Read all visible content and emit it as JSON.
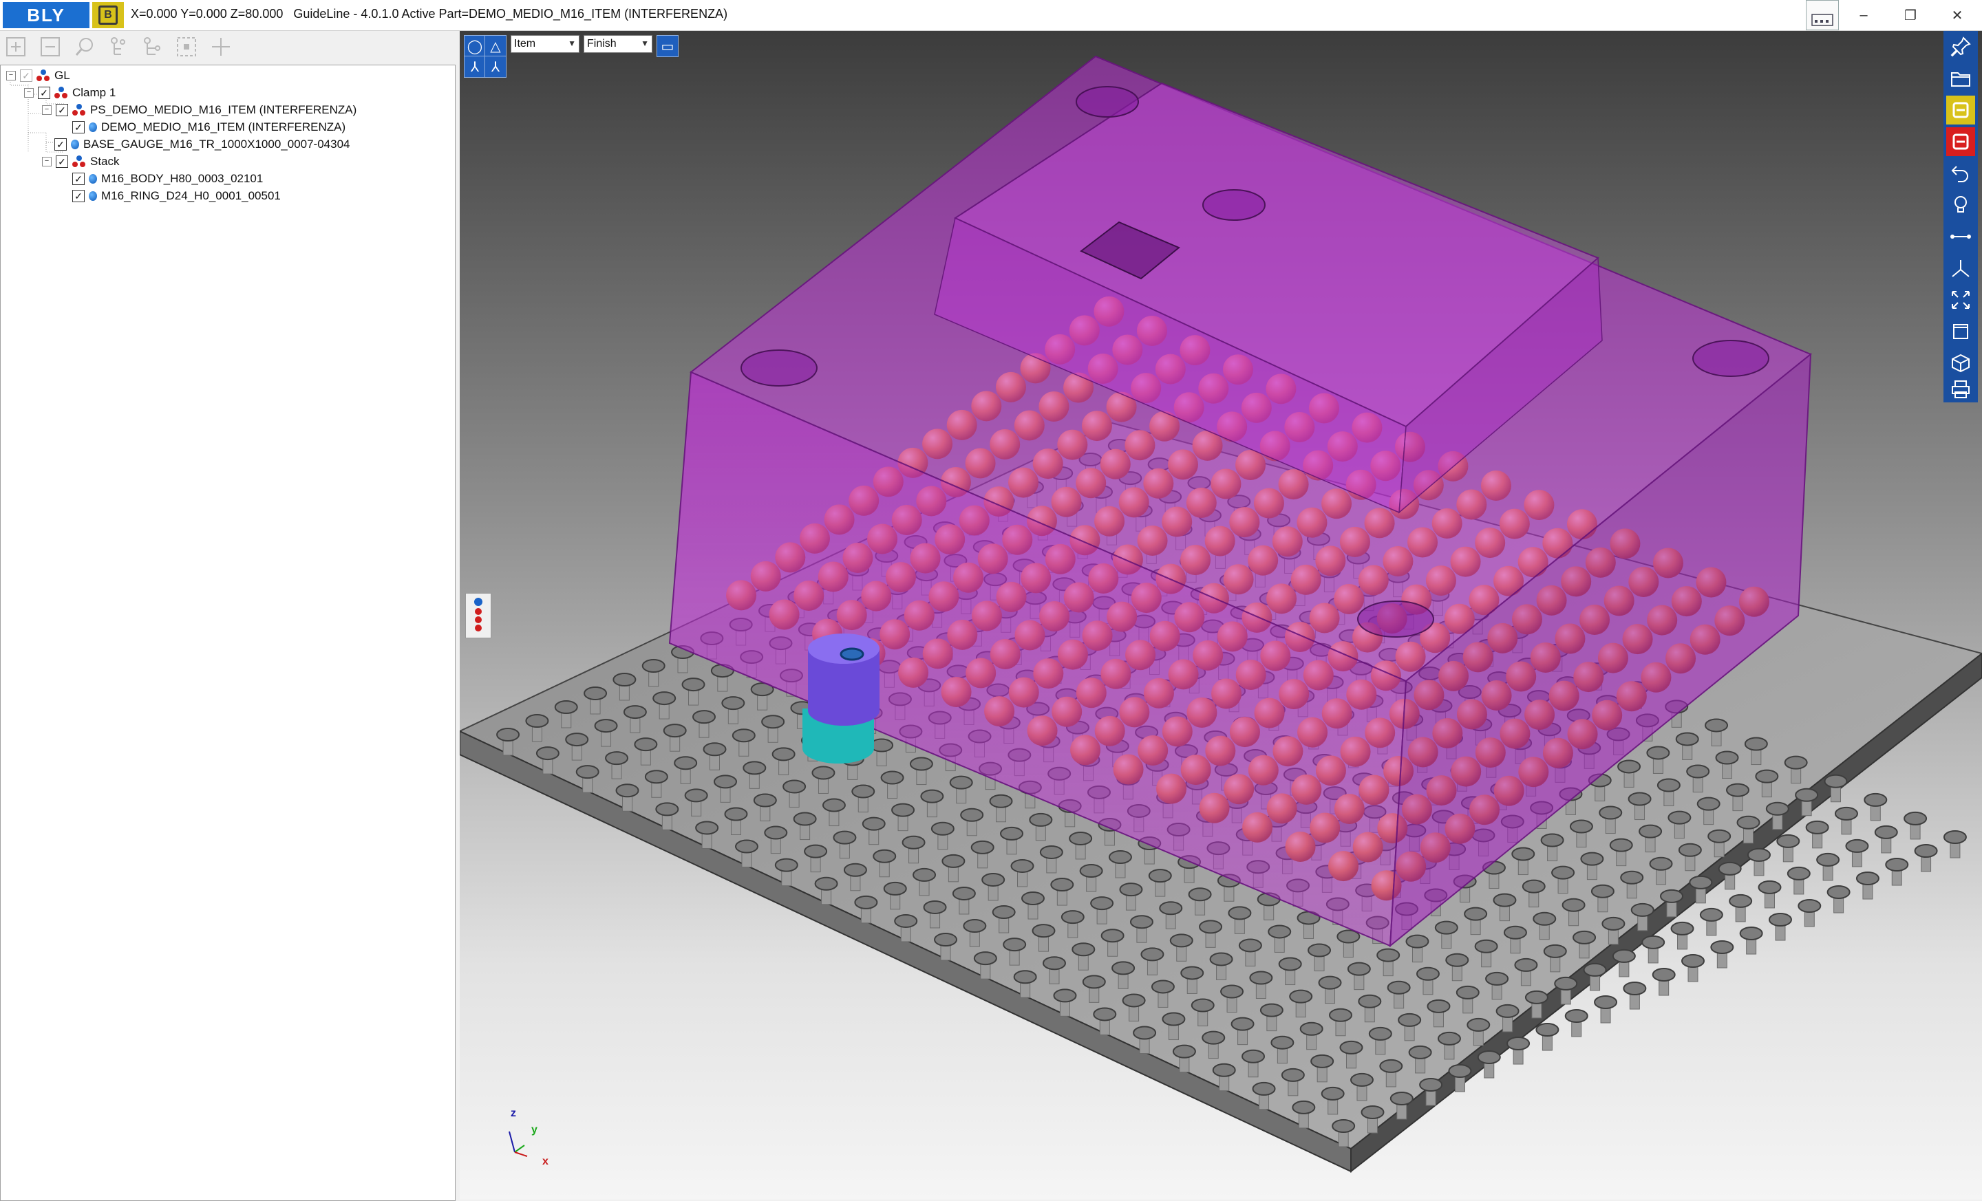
{
  "app": {
    "logo_text": "BLY",
    "title": "X=0.000 Y=0.000 Z=80.000   GuideLine - 4.0.1.0 Active Part=DEMO_MEDIO_M16_ITEM (INTERFERENZA)"
  },
  "window_controls": {
    "minimize": "–",
    "restore": "❐",
    "close": "✕"
  },
  "tree": {
    "nodes": [
      {
        "label": "GL",
        "level": 0,
        "type": "assembly"
      },
      {
        "label": "Clamp 1",
        "level": 1,
        "type": "assembly"
      },
      {
        "label": "PS_DEMO_MEDIO_M16_ITEM (INTERFERENZA)",
        "level": 2,
        "type": "assembly"
      },
      {
        "label": "DEMO_MEDIO_M16_ITEM (INTERFERENZA)",
        "level": 3,
        "type": "part"
      },
      {
        "label": "BASE_GAUGE_M16_TR_1000X1000_0007-04304",
        "level": 2,
        "type": "part"
      },
      {
        "label": "Stack",
        "level": 2,
        "type": "assembly"
      },
      {
        "label": "M16_BODY_H80_0003_02101",
        "level": 3,
        "type": "part"
      },
      {
        "label": "M16_RING_D24_H0_0001_00501",
        "level": 3,
        "type": "part"
      }
    ]
  },
  "viewport": {
    "select_mode": "Item",
    "select_finish": "Finish"
  },
  "axis": {
    "z": "z",
    "y": "y",
    "x": "x"
  },
  "colors": {
    "brand_blue": "#1b6fd1",
    "brand_yellow": "#d8c21a",
    "part_magenta": "#c020d8",
    "pin_orange": "#e08a2a",
    "toolbar_blue": "#1a4fa0",
    "stop_red": "#d81e1e"
  },
  "right_toolbar_icons": [
    "pin-icon",
    "open-folder-icon",
    "yellow-b-icon",
    "red-b-icon",
    "undo-icon",
    "lightbulb-icon",
    "measure-icon",
    "axis-icon",
    "fit-icon",
    "view-box-icon",
    "iso-view-icon",
    "print-icon"
  ]
}
